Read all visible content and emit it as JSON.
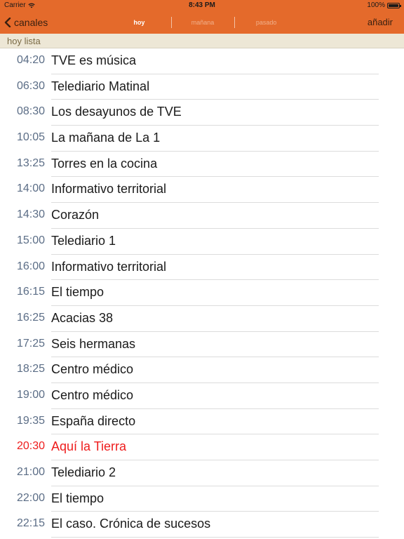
{
  "status_bar": {
    "carrier": "Carrier",
    "time": "8:43 PM",
    "battery": "100%"
  },
  "navbar": {
    "back_label": "canales",
    "segments": [
      "hoy",
      "mañana",
      "pasado"
    ],
    "selected_segment": "hoy",
    "add_label": "añadir"
  },
  "section": {
    "title": "hoy lista"
  },
  "colors": {
    "bar": "#e46a2b",
    "section_bg": "#ede7d6",
    "current_program": "#ee1c1c",
    "time_text": "#5b6d86"
  },
  "icons": {
    "back": "chevron-left-icon",
    "wifi": "wifi-icon",
    "battery": "battery-icon"
  },
  "programs": [
    {
      "time": "04:20",
      "title": "TVE es música"
    },
    {
      "time": "06:30",
      "title": "Telediario Matinal"
    },
    {
      "time": "08:30",
      "title": "Los desayunos de TVE"
    },
    {
      "time": "10:05",
      "title": "La mañana de La 1"
    },
    {
      "time": "13:25",
      "title": "Torres en la cocina"
    },
    {
      "time": "14:00",
      "title": "Informativo territorial"
    },
    {
      "time": "14:30",
      "title": "Corazón"
    },
    {
      "time": "15:00",
      "title": "Telediario 1"
    },
    {
      "time": "16:00",
      "title": "Informativo territorial"
    },
    {
      "time": "16:15",
      "title": "El tiempo"
    },
    {
      "time": "16:25",
      "title": "Acacias 38"
    },
    {
      "time": "17:25",
      "title": "Seis hermanas"
    },
    {
      "time": "18:25",
      "title": "Centro médico"
    },
    {
      "time": "19:00",
      "title": "Centro médico"
    },
    {
      "time": "19:35",
      "title": "España directo"
    },
    {
      "time": "20:30",
      "title": "Aquí la Tierra",
      "current": true
    },
    {
      "time": "21:00",
      "title": "Telediario 2"
    },
    {
      "time": "22:00",
      "title": "El tiempo"
    },
    {
      "time": "22:15",
      "title": "El caso. Crónica de sucesos"
    }
  ]
}
